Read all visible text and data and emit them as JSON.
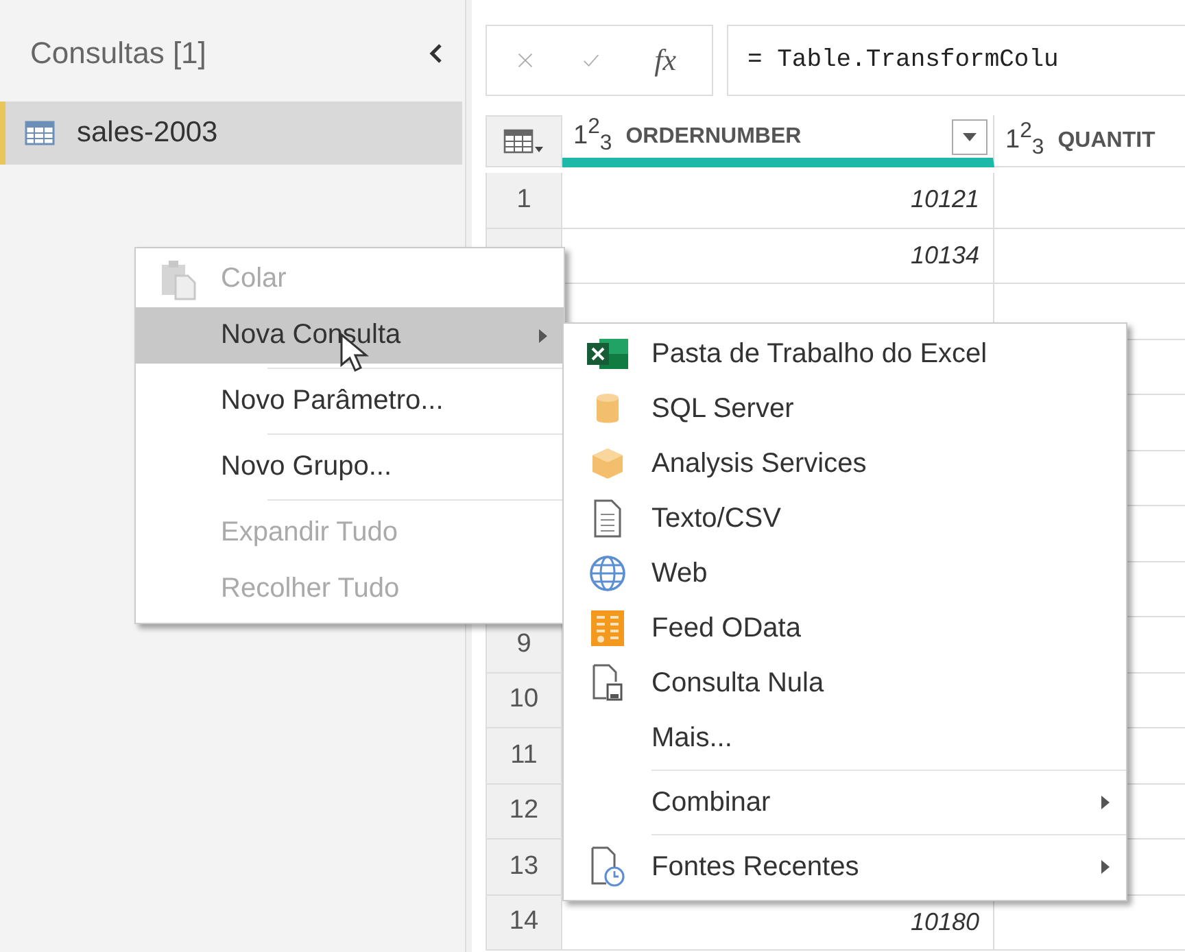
{
  "queries_pane": {
    "title": "Consultas [1]",
    "items": [
      {
        "name": "sales-2003",
        "selected": true
      }
    ]
  },
  "formula_bar": {
    "function_label": "fx",
    "formula": "= Table.TransformColu"
  },
  "table": {
    "columns": [
      {
        "type_label": "1$^{2}$$_{3}$",
        "name": "ORDERNUMBER",
        "selected": true
      },
      {
        "type_label": "1$^{2}$$_{3}$",
        "name": "QUANTIT",
        "selected": false
      }
    ],
    "rows": [
      {
        "number": "1",
        "ordernumber": "10121"
      },
      {
        "ordernumber": "10134"
      },
      {},
      {},
      {},
      {},
      {},
      {},
      {
        "number": "9"
      },
      {
        "number": "10"
      },
      {
        "number": "11"
      },
      {
        "number": "12"
      },
      {
        "number": "13"
      },
      {
        "number": "14",
        "ordernumber": "10180"
      }
    ]
  },
  "context_menu": {
    "items": [
      {
        "kind": "item",
        "label": "Colar",
        "disabled": true,
        "selected": false,
        "submenu": false
      },
      {
        "kind": "item",
        "label": "Nova Consulta",
        "disabled": false,
        "selected": true,
        "submenu": true
      },
      {
        "kind": "separator"
      },
      {
        "kind": "item",
        "label": "Novo Parâmetro...",
        "disabled": false,
        "selected": false,
        "submenu": false
      },
      {
        "kind": "separator"
      },
      {
        "kind": "item",
        "label": "Novo Grupo...",
        "disabled": false,
        "selected": false,
        "submenu": false
      },
      {
        "kind": "separator"
      },
      {
        "kind": "item",
        "label": "Expandir Tudo",
        "disabled": true,
        "selected": false,
        "submenu": false
      },
      {
        "kind": "item",
        "label": "Recolher Tudo",
        "disabled": true,
        "selected": false,
        "submenu": false
      }
    ]
  },
  "submenu": {
    "items": [
      {
        "kind": "item",
        "label": "Pasta de Trabalho do Excel",
        "disabled": false,
        "selected": false,
        "submenu": false
      },
      {
        "kind": "item",
        "label": "SQL Server",
        "disabled": false,
        "selected": false,
        "submenu": false
      },
      {
        "kind": "item",
        "label": "Analysis Services",
        "disabled": false,
        "selected": false,
        "submenu": false
      },
      {
        "kind": "item",
        "label": "Texto/CSV",
        "disabled": false,
        "selected": false,
        "submenu": false
      },
      {
        "kind": "item",
        "label": "Web",
        "disabled": false,
        "selected": false,
        "submenu": false
      },
      {
        "kind": "item",
        "label": "Feed OData",
        "disabled": false,
        "selected": false,
        "submenu": false
      },
      {
        "kind": "item",
        "label": "Consulta Nula",
        "disabled": false,
        "selected": false,
        "submenu": false
      },
      {
        "kind": "item",
        "label": "Mais...",
        "disabled": false,
        "selected": false,
        "submenu": false
      },
      {
        "kind": "separator"
      },
      {
        "kind": "item",
        "label": "Combinar",
        "disabled": false,
        "selected": false,
        "submenu": true
      },
      {
        "kind": "separator"
      },
      {
        "kind": "item",
        "label": "Fontes Recentes",
        "disabled": false,
        "selected": false,
        "submenu": true
      }
    ]
  }
}
